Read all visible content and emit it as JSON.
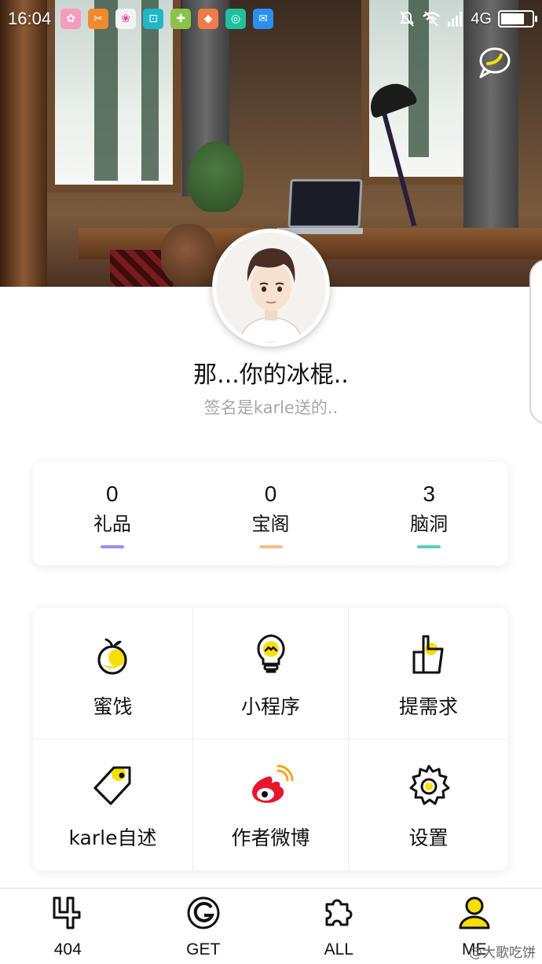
{
  "status_bar": {
    "time": "16:04",
    "network": "4G",
    "battery_level": 0.75,
    "app_icons": [
      {
        "name": "butterfly-app-icon",
        "color": "#f59cbc",
        "glyph": "✿"
      },
      {
        "name": "scissors-app-icon",
        "color": "#f08a2a",
        "glyph": "✂"
      },
      {
        "name": "petal-app-icon",
        "color": "#f3f3f3",
        "glyph": "❀"
      },
      {
        "name": "scan-app-icon",
        "color": "#1fb8c8",
        "glyph": "⊡"
      },
      {
        "name": "shopping-bag-app-icon",
        "color": "#8bc34a",
        "glyph": "✚"
      },
      {
        "name": "orange-bag-app-icon",
        "color": "#f07a4a",
        "glyph": "◆"
      },
      {
        "name": "ring-app-icon",
        "color": "#1fbfa0",
        "glyph": "◎"
      },
      {
        "name": "message-app-icon",
        "color": "#2a8ff0",
        "glyph": "✉"
      }
    ]
  },
  "profile": {
    "username": "那...你的冰棍..",
    "signature": "签名是karle送的.."
  },
  "stats": [
    {
      "value": "0",
      "label": "礼品",
      "color": "#a08cf0"
    },
    {
      "value": "0",
      "label": "宝阁",
      "color": "#f7be8a"
    },
    {
      "value": "3",
      "label": "脑洞",
      "color": "#5ccfb8"
    }
  ],
  "menu": [
    {
      "label": "蜜饯",
      "icon": "orange-icon"
    },
    {
      "label": "小程序",
      "icon": "bulb-icon"
    },
    {
      "label": "提需求",
      "icon": "thumb-up-icon"
    },
    {
      "label": "karle自述",
      "icon": "tag-icon"
    },
    {
      "label": "作者微博",
      "icon": "weibo-icon"
    },
    {
      "label": "设置",
      "icon": "gear-icon"
    }
  ],
  "nav": [
    {
      "label": "404",
      "icon": "four-icon"
    },
    {
      "label": "GET",
      "icon": "g-icon"
    },
    {
      "label": "ALL",
      "icon": "puzzle-icon"
    },
    {
      "label": "ME",
      "icon": "person-icon",
      "active": true
    }
  ],
  "watermark": "@大歌吃饼",
  "colors": {
    "accent": "#f7e000"
  }
}
